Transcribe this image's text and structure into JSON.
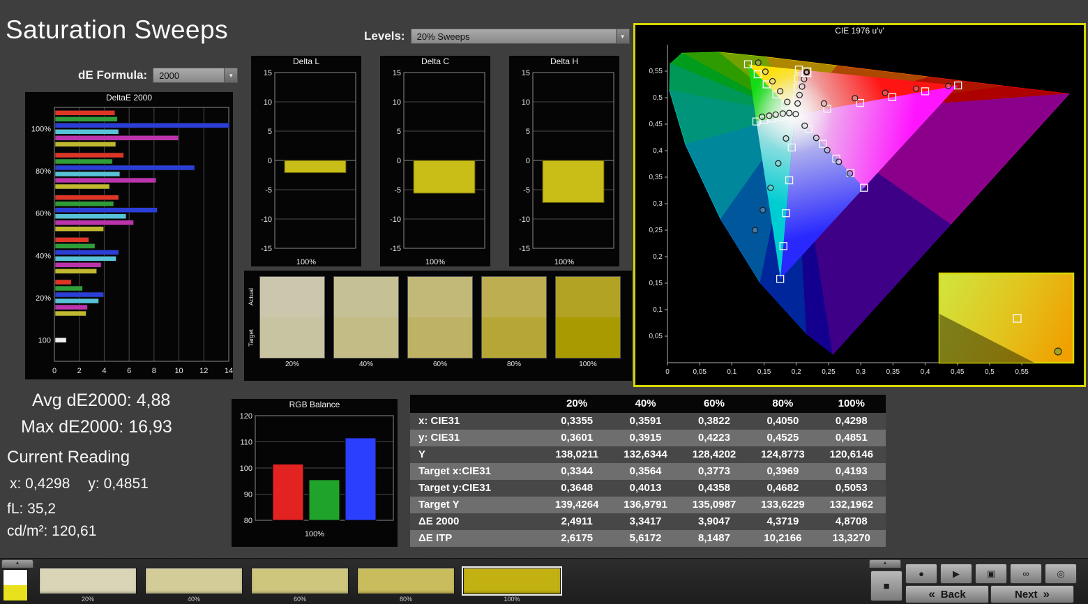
{
  "page": {
    "title": "Saturation Sweeps"
  },
  "controls": {
    "de_formula_label": "dE Formula:",
    "de_formula_value": "2000",
    "levels_label": "Levels:",
    "levels_value": "20% Sweeps",
    "dropdown_arrow": "▼"
  },
  "readouts": {
    "avg_de2000": "Avg dE2000: 4,88",
    "max_de2000": "Max dE2000: 16,93",
    "current_reading_title": "Current Reading",
    "x_value": "x: 0,4298",
    "y_value": "y: 0,4851",
    "fl_value": "fL: 35,2",
    "luminance_value": "cd/m²: 120,61"
  },
  "chart_data": [
    {
      "id": "deltae2000",
      "type": "bar",
      "orientation": "horizontal",
      "title": "DeltaE 2000",
      "xlim": [
        0,
        14
      ],
      "xticks": [
        0,
        2,
        4,
        6,
        8,
        10,
        12,
        14
      ],
      "groups": [
        {
          "label": "100%",
          "bars": [
            {
              "name": "red",
              "color": "#df3527",
              "value": 4.8
            },
            {
              "name": "green",
              "color": "#2f9e38",
              "value": 5.0
            },
            {
              "name": "blue",
              "color": "#2b3fd8",
              "value": 16.93
            },
            {
              "name": "cyan",
              "color": "#58c3d8",
              "value": 5.1
            },
            {
              "name": "magenta",
              "color": "#bc34ac",
              "value": 9.9
            },
            {
              "name": "yellow",
              "color": "#c0b92f",
              "value": 4.87
            }
          ]
        },
        {
          "label": "80%",
          "bars": [
            {
              "name": "red",
              "color": "#df3527",
              "value": 5.5
            },
            {
              "name": "green",
              "color": "#2f9e38",
              "value": 4.6
            },
            {
              "name": "blue",
              "color": "#2b3fd8",
              "value": 11.2
            },
            {
              "name": "cyan",
              "color": "#58c3d8",
              "value": 5.2
            },
            {
              "name": "magenta",
              "color": "#bc34ac",
              "value": 8.1
            },
            {
              "name": "yellow",
              "color": "#c0b92f",
              "value": 4.37
            }
          ]
        },
        {
          "label": "60%",
          "bars": [
            {
              "name": "red",
              "color": "#df3527",
              "value": 5.1
            },
            {
              "name": "green",
              "color": "#2f9e38",
              "value": 4.7
            },
            {
              "name": "blue",
              "color": "#2b3fd8",
              "value": 8.2
            },
            {
              "name": "cyan",
              "color": "#58c3d8",
              "value": 5.7
            },
            {
              "name": "magenta",
              "color": "#bc34ac",
              "value": 6.3
            },
            {
              "name": "yellow",
              "color": "#c0b92f",
              "value": 3.9
            }
          ]
        },
        {
          "label": "40%",
          "bars": [
            {
              "name": "red",
              "color": "#df3527",
              "value": 2.7
            },
            {
              "name": "green",
              "color": "#2f9e38",
              "value": 3.2
            },
            {
              "name": "blue",
              "color": "#2b3fd8",
              "value": 5.1
            },
            {
              "name": "cyan",
              "color": "#58c3d8",
              "value": 4.9
            },
            {
              "name": "magenta",
              "color": "#bc34ac",
              "value": 3.7
            },
            {
              "name": "yellow",
              "color": "#c0b92f",
              "value": 3.34
            }
          ]
        },
        {
          "label": "20%",
          "bars": [
            {
              "name": "red",
              "color": "#df3527",
              "value": 1.3
            },
            {
              "name": "green",
              "color": "#2f9e38",
              "value": 2.2
            },
            {
              "name": "blue",
              "color": "#2b3fd8",
              "value": 3.9
            },
            {
              "name": "cyan",
              "color": "#58c3d8",
              "value": 3.5
            },
            {
              "name": "magenta",
              "color": "#bc34ac",
              "value": 2.6
            },
            {
              "name": "yellow",
              "color": "#c0b92f",
              "value": 2.49
            }
          ]
        },
        {
          "label": "100",
          "bars": [
            {
              "name": "white",
              "color": "#f0f0f0",
              "value": 0.9
            }
          ]
        }
      ]
    },
    {
      "id": "delta_l",
      "type": "bar",
      "title": "Delta L",
      "ylim": [
        -15,
        15
      ],
      "yticks": [
        15,
        10,
        5,
        0,
        -5,
        -10,
        -15
      ],
      "categories": [
        "100%"
      ],
      "values": [
        -2.1
      ],
      "bar_color": "#c9bd17"
    },
    {
      "id": "delta_c",
      "type": "bar",
      "title": "Delta C",
      "ylim": [
        -15,
        15
      ],
      "yticks": [
        15,
        10,
        5,
        0,
        -5,
        -10,
        -15
      ],
      "categories": [
        "100%"
      ],
      "values": [
        -5.6
      ],
      "bar_color": "#c9bd17"
    },
    {
      "id": "delta_h",
      "type": "bar",
      "title": "Delta H",
      "ylim": [
        -15,
        15
      ],
      "yticks": [
        15,
        10,
        5,
        0,
        -5,
        -10,
        -15
      ],
      "categories": [
        "100%"
      ],
      "values": [
        -7.2
      ],
      "bar_color": "#c9bd17"
    },
    {
      "id": "rgb_balance",
      "type": "bar",
      "title": "RGB Balance",
      "ylim": [
        80,
        120
      ],
      "yticks": [
        120,
        110,
        100,
        90,
        80
      ],
      "categories": [
        "100%"
      ],
      "series": [
        {
          "name": "Red",
          "color": "#e32222",
          "value": 101.5
        },
        {
          "name": "Green",
          "color": "#1fa32b",
          "value": 95.5
        },
        {
          "name": "Blue",
          "color": "#2b3fff",
          "value": 111.5
        }
      ]
    },
    {
      "id": "cie_diagram",
      "type": "scatter",
      "title": "CIE 1976 u'v'",
      "xticks": [
        "0",
        "0,05",
        "0,1",
        "0,15",
        "0,2",
        "0,25",
        "0,3",
        "0,35",
        "0,4",
        "0,45",
        "0,5",
        "0,55"
      ],
      "yticks": [
        "0",
        "0,05",
        "0,1",
        "0,15",
        "0,2",
        "0,25",
        "0,3",
        "0,35",
        "0,4",
        "0,45",
        "0,5",
        "0,55"
      ],
      "white_point": [
        0.1978,
        0.4683
      ],
      "current": [
        0.216,
        0.548
      ],
      "targets": [
        [
          0.248,
          0.479
        ],
        [
          0.299,
          0.49
        ],
        [
          0.349,
          0.501
        ],
        [
          0.4,
          0.512
        ],
        [
          0.451,
          0.523
        ],
        [
          0.183,
          0.487
        ],
        [
          0.169,
          0.506
        ],
        [
          0.154,
          0.525
        ],
        [
          0.14,
          0.544
        ],
        [
          0.125,
          0.563
        ],
        [
          0.193,
          0.406
        ],
        [
          0.189,
          0.344
        ],
        [
          0.184,
          0.282
        ],
        [
          0.18,
          0.22
        ],
        [
          0.175,
          0.158
        ],
        [
          0.186,
          0.466
        ],
        [
          0.174,
          0.463
        ],
        [
          0.162,
          0.461
        ],
        [
          0.15,
          0.458
        ],
        [
          0.138,
          0.455
        ],
        [
          0.219,
          0.441
        ],
        [
          0.241,
          0.413
        ],
        [
          0.262,
          0.385
        ],
        [
          0.284,
          0.358
        ],
        [
          0.305,
          0.33
        ],
        [
          0.199,
          0.485
        ],
        [
          0.201,
          0.502
        ],
        [
          0.202,
          0.519
        ],
        [
          0.203,
          0.536
        ],
        [
          0.204,
          0.553
        ],
        [
          0.198,
          0.468
        ]
      ],
      "measured": [
        [
          0.243,
          0.489
        ],
        [
          0.291,
          0.499
        ],
        [
          0.338,
          0.509
        ],
        [
          0.386,
          0.517
        ],
        [
          0.436,
          0.522
        ],
        [
          0.186,
          0.492
        ],
        [
          0.175,
          0.512
        ],
        [
          0.163,
          0.531
        ],
        [
          0.152,
          0.549
        ],
        [
          0.141,
          0.566
        ],
        [
          0.184,
          0.423
        ],
        [
          0.172,
          0.376
        ],
        [
          0.16,
          0.33
        ],
        [
          0.148,
          0.288
        ],
        [
          0.136,
          0.25
        ],
        [
          0.189,
          0.471
        ],
        [
          0.179,
          0.47
        ],
        [
          0.168,
          0.468
        ],
        [
          0.158,
          0.466
        ],
        [
          0.147,
          0.464
        ],
        [
          0.213,
          0.447
        ],
        [
          0.231,
          0.424
        ],
        [
          0.248,
          0.401
        ],
        [
          0.266,
          0.379
        ],
        [
          0.283,
          0.357
        ],
        [
          0.202,
          0.489
        ],
        [
          0.205,
          0.505
        ],
        [
          0.209,
          0.521
        ],
        [
          0.212,
          0.535
        ],
        [
          0.216,
          0.548
        ],
        [
          0.199,
          0.469
        ]
      ]
    }
  ],
  "comparison_swatches": {
    "row_labels": [
      "Actual",
      "Target"
    ],
    "levels": [
      {
        "label": "20%",
        "actual": "#cbc7ad",
        "target": "#c8c4a2"
      },
      {
        "label": "40%",
        "actual": "#c6c095",
        "target": "#c3bc86"
      },
      {
        "label": "60%",
        "actual": "#c2b979",
        "target": "#beb364"
      },
      {
        "label": "80%",
        "actual": "#bdae52",
        "target": "#b6a636"
      },
      {
        "label": "100%",
        "actual": "#b2a324",
        "target": "#a89a00"
      }
    ]
  },
  "results_table": {
    "columns": [
      "",
      "20%",
      "40%",
      "60%",
      "80%",
      "100%"
    ],
    "rows": [
      {
        "label": "x: CIE31",
        "values": [
          "0,3355",
          "0,3591",
          "0,3822",
          "0,4050",
          "0,4298"
        ]
      },
      {
        "label": "y: CIE31",
        "values": [
          "0,3601",
          "0,3915",
          "0,4223",
          "0,4525",
          "0,4851"
        ]
      },
      {
        "label": "Y",
        "values": [
          "138,0211",
          "132,6344",
          "128,4202",
          "124,8773",
          "120,6146"
        ]
      },
      {
        "label": "Target x:CIE31",
        "values": [
          "0,3344",
          "0,3564",
          "0,3773",
          "0,3969",
          "0,4193"
        ]
      },
      {
        "label": "Target y:CIE31",
        "values": [
          "0,3648",
          "0,4013",
          "0,4358",
          "0,4682",
          "0,5053"
        ]
      },
      {
        "label": "Target Y",
        "values": [
          "139,4264",
          "136,9791",
          "135,0987",
          "133,6229",
          "132,1962"
        ]
      },
      {
        "label": "ΔE 2000",
        "values": [
          "2,4911",
          "3,3417",
          "3,9047",
          "4,3719",
          "4,8708"
        ]
      },
      {
        "label": "ΔE ITP",
        "values": [
          "2,6175",
          "5,6172",
          "8,1487",
          "10,2166",
          "13,3270"
        ]
      }
    ]
  },
  "toolbar": {
    "collapse_icon": "▲",
    "corner_swatch": {
      "top": "#ffffff",
      "bottom": "#e9e11e"
    },
    "patch_swatches": [
      {
        "label": "20%",
        "color": "#d9d5b6",
        "selected": false
      },
      {
        "label": "40%",
        "color": "#d3cc99",
        "selected": false
      },
      {
        "label": "60%",
        "color": "#cec67d",
        "selected": false
      },
      {
        "label": "80%",
        "color": "#c9bc5c",
        "selected": false
      },
      {
        "label": "100%",
        "color": "#c3b112",
        "selected": true
      }
    ],
    "stop_button_icon": "■",
    "buttons": [
      {
        "name": "record",
        "icon": "●"
      },
      {
        "name": "play",
        "icon": "▶"
      },
      {
        "name": "capture",
        "icon": "▣"
      },
      {
        "name": "continuous",
        "icon": "∞"
      },
      {
        "name": "power",
        "icon": "◎"
      }
    ],
    "back_arrow": "«",
    "back_label": "Back",
    "next_label": "Next",
    "next_arrow": "»"
  }
}
